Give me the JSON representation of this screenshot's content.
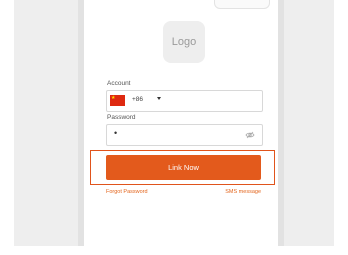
{
  "logo": {
    "text": "Logo"
  },
  "form": {
    "account_label": "Account",
    "country_code": "+86",
    "password_label": "Password",
    "password_value": "•"
  },
  "primary_button": {
    "label": "Link Now"
  },
  "links": {
    "forgot_password": "Forgot Password",
    "sms_message": "SMS message"
  },
  "colors": {
    "accent": "#e35a1c",
    "highlight": "#e0541c",
    "flag_red": "#de2910"
  },
  "icons": {
    "country_flag": "china-flag-icon",
    "dropdown": "chevron-down-icon",
    "password_visibility": "eye-off-icon"
  }
}
